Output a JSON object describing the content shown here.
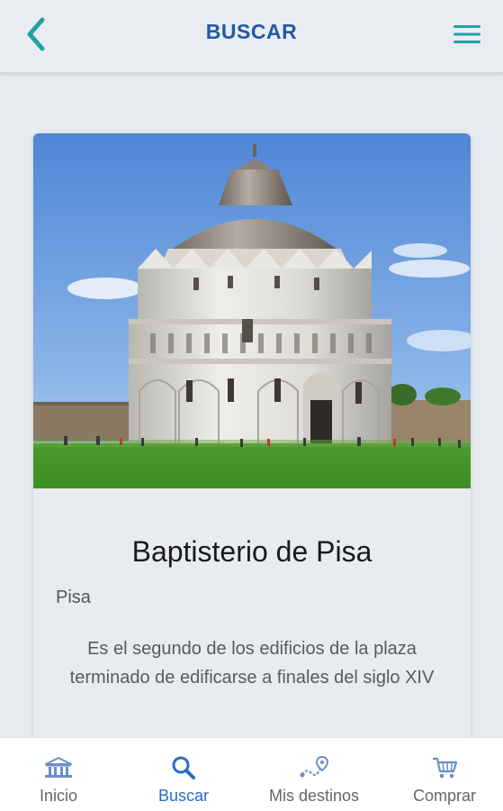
{
  "header": {
    "title": "BUSCAR"
  },
  "card": {
    "title": "Baptisterio de Pisa",
    "city": "Pisa",
    "description": "Es el segundo de los edificios de la plaza terminado de edificarse a finales del siglo XIV"
  },
  "bottom_nav": {
    "items": [
      {
        "label": "Inicio",
        "icon": "museum-icon",
        "active": false
      },
      {
        "label": "Buscar",
        "icon": "search-icon",
        "active": true
      },
      {
        "label": "Mis destinos",
        "icon": "route-icon",
        "active": false
      },
      {
        "label": "Comprar",
        "icon": "cart-icon",
        "active": false
      }
    ]
  },
  "colors": {
    "accent_teal": "#1fa3a8",
    "brand_blue": "#1f5aa6",
    "active_nav": "#2a6cc4",
    "background": "#e6ebf0"
  }
}
